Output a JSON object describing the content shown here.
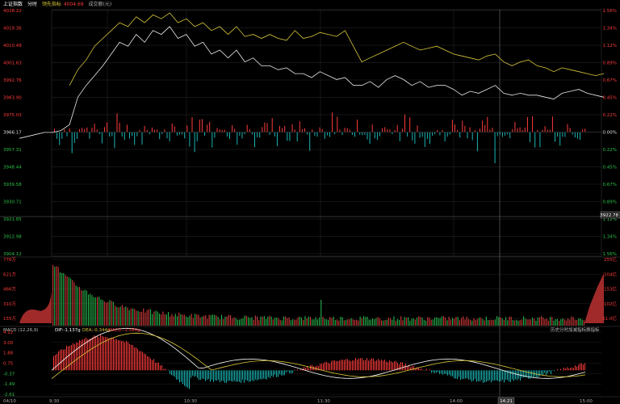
{
  "header": {
    "index_name": "上证指数",
    "mode": "分时",
    "lead_label": "领先指标",
    "lead_value": "4004.69",
    "volume_label": "成交额(元)"
  },
  "colors": {
    "up": "#ff3b3b",
    "down": "#1bb5b5",
    "neutral": "#e0e0e0",
    "price_line": "#e8e8e8",
    "lead_line": "#d8c83a",
    "grid": "#2a2a2a",
    "volume_green": "#27b24a",
    "volume_red": "#d23a3a"
  },
  "price_axis": {
    "left": [
      "4028.22",
      "4019.36",
      "4010.49",
      "4001.63",
      "3992.76",
      "3983.90",
      "3975.03",
      "3966.17",
      "3957.31",
      "3948.44",
      "3939.58",
      "3930.71",
      "3921.85",
      "3912.98",
      "3904.12"
    ],
    "right": [
      "1.56%",
      "1.34%",
      "1.12%",
      "0.89%",
      "0.67%",
      "0.45%",
      "0.22%",
      "0.00%",
      "0.22%",
      "0.45%",
      "0.67%",
      "0.89%",
      "1.12%",
      "1.34%",
      "1.56%"
    ],
    "current_price": "3922.78"
  },
  "volume_axis": {
    "left": [
      "776万",
      "621万",
      "466万",
      "310万",
      "155万"
    ],
    "right": [
      "255亿",
      "204亿",
      "153亿",
      "102亿",
      "51.0亿"
    ]
  },
  "macd": {
    "title": "MACD (12,26,9)",
    "dif": "DIF:-1.137g",
    "dea": "DEA:-0.344g",
    "macd_val": "MACD:-1.586g",
    "axis": [
      "4.12",
      "3.00",
      "1.88",
      "0.75",
      "-0.37",
      "-1.49",
      "-2.61"
    ],
    "buttons": [
      "历史分时",
      "加减指标",
      "换指标"
    ]
  },
  "time_axis": {
    "labels": [
      "04/10",
      "9:30",
      "10:30",
      "11:30",
      "14:00",
      "15:00"
    ],
    "cursor_time": "14:21"
  },
  "chart_data": {
    "type": "line",
    "series": [
      {
        "name": "上证指数",
        "values": [
          3963,
          3964,
          3965,
          3966,
          3966,
          3967,
          3970,
          3984,
          3990,
          3995,
          4000,
          4006,
          4012,
          4010,
          4016,
          4012,
          4018,
          4016,
          4020,
          4014,
          4016,
          4010,
          4012,
          4006,
          4008,
          4004,
          4008,
          4002,
          4004,
          4000,
          4000,
          3998,
          3999,
          3996,
          3996,
          3994,
          3997,
          3995,
          3993,
          3994,
          3990,
          3990,
          3992,
          3989,
          3993,
          3995,
          3993,
          3990,
          3992,
          3989,
          3990,
          3990,
          3988,
          3985,
          3987,
          3986,
          3988,
          3990,
          3986,
          3985,
          3986,
          3985,
          3985,
          3984,
          3983,
          3986,
          3987,
          3988,
          3986,
          3985,
          3984
        ]
      },
      {
        "name": "领先指标",
        "values": [
          null,
          null,
          null,
          null,
          null,
          null,
          3990,
          3998,
          4003,
          4010,
          4014,
          4018,
          4022,
          4020,
          4025,
          4022,
          4026,
          4024,
          4027,
          4022,
          4024,
          4020,
          4022,
          4018,
          4020,
          4016,
          4020,
          4015,
          4016,
          4014,
          4016,
          4014,
          4013,
          4018,
          4014,
          4015,
          4017,
          4016,
          4015,
          4018,
          4010,
          4002,
          4004,
          4006,
          4008,
          4010,
          4012,
          4010,
          4008,
          4009,
          4010,
          4008,
          4006,
          4005,
          4004,
          4003,
          4005,
          4006,
          4002,
          4000,
          4002,
          4003,
          4000,
          3999,
          3997,
          3999,
          3998,
          3997,
          3996,
          3995,
          3996
        ]
      }
    ]
  }
}
